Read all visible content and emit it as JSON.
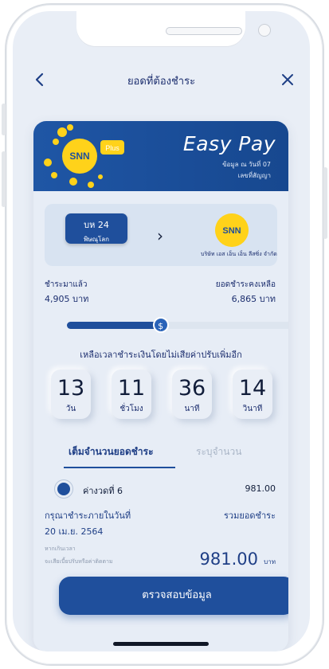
{
  "header": {
    "title": "ยอดที่ต้องชำระ"
  },
  "banner": {
    "badge": "Plus",
    "brand_title": "Easy Pay",
    "info_line1": "ข้อมูล ณ วันที่ 07",
    "info_line2": "เลขที่สัญญา"
  },
  "route": {
    "plate_number": "บห 24",
    "plate_province": "พิษณุโลก",
    "arrow": "›",
    "logo_text": "SNN",
    "company": "บริษัท เอส เอ็น เอ็น ลีสซิ่ง จำกัด"
  },
  "progress": {
    "paid_label": "ชำระมาแล้ว",
    "paid_value": "4,905 บาท",
    "remain_label": "ยอดชำระคงเหลือ",
    "remain_value": "6,865 บาท",
    "fraction_paid": 0.417,
    "knob_icon": "$"
  },
  "countdown": {
    "label": "เหลือเวลาชำระเงินโดยไม่เสียค่าปรับเพิ่มอีก",
    "items": [
      {
        "value": "13",
        "unit": "วัน"
      },
      {
        "value": "11",
        "unit": "ชั่วโมง"
      },
      {
        "value": "36",
        "unit": "นาที"
      },
      {
        "value": "14",
        "unit": "วินาที"
      }
    ]
  },
  "tabs": {
    "full": "เต็มจำนวนยอดชำระ",
    "specify": "ระบุจำนวน"
  },
  "installment": {
    "label": "ค่างวดที่ 6",
    "amount": "981.00"
  },
  "due": {
    "label": "กรุณาชำระภายในวันที่",
    "date": "20 เม.ย. 2564",
    "late_note1": "หากเกินเวลา",
    "late_note2": "จะเสียเบี้ยปรับหรือค่าติดตาม"
  },
  "total": {
    "label": "รวมยอดชำระ",
    "amount": "981.00",
    "unit": "บาท"
  },
  "verify_button": "ตรวจสอบข้อมูล",
  "colors": {
    "primary": "#1f4f9c",
    "background": "#e9eef6",
    "accent_yellow": "#ffd21a"
  }
}
